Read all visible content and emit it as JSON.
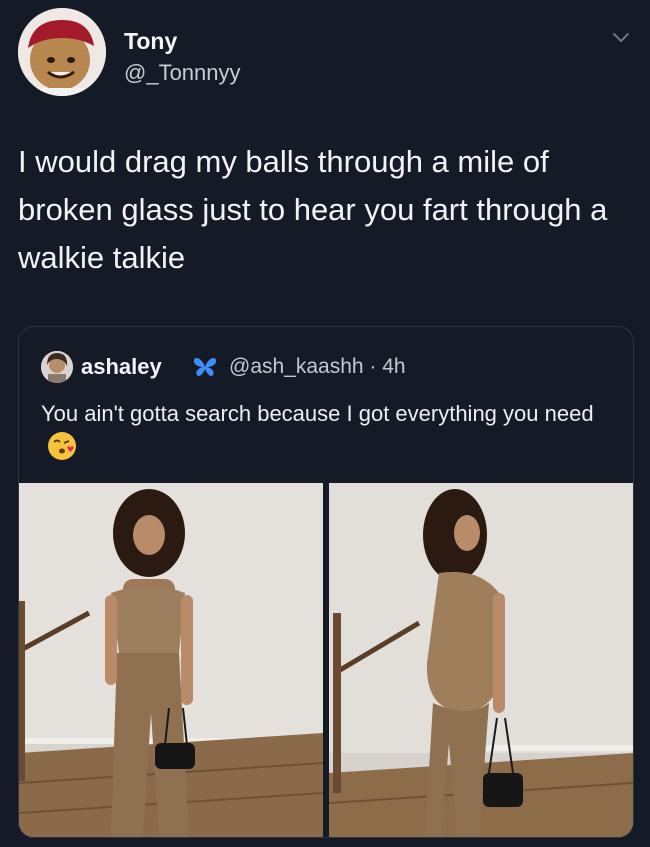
{
  "tweet": {
    "author_name": "Tony",
    "author_handle": "@_Tonnnyy",
    "text": "I would drag my balls through a mile of broken glass just to hear you fart through a walkie talkie"
  },
  "quoted_tweet": {
    "author_name": "ashaley",
    "author_handle": "@ash_kaashh · 4h",
    "text": "You ain't gotta search because I got everything you need"
  },
  "icons": {
    "menu": "chevron-down-icon",
    "badge": "butterfly-icon",
    "emoji": "kissing-face-emoji-icon"
  },
  "colors": {
    "background": "#151b26",
    "card_border": "#2d3542",
    "badge_blue": "#3f8cff"
  }
}
